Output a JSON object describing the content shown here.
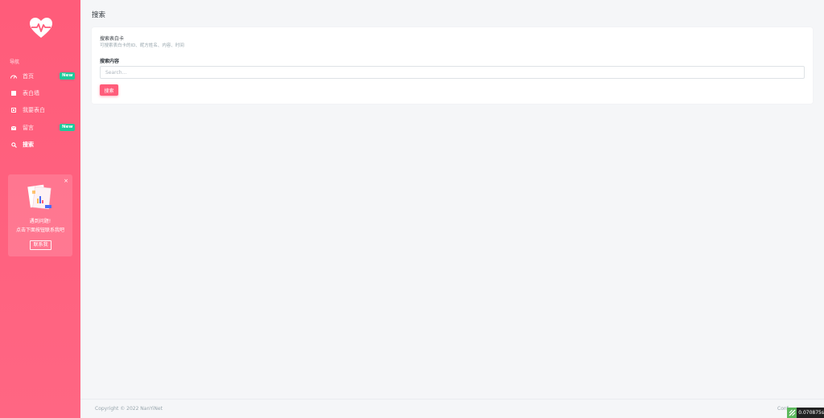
{
  "sidebar": {
    "nav_heading": "导航",
    "items": [
      {
        "label": "首页",
        "icon": "dashboard-icon",
        "badge": "New"
      },
      {
        "label": "表白墙",
        "icon": "grid-icon",
        "badge": ""
      },
      {
        "label": "我要表白",
        "icon": "edit-square-icon",
        "badge": ""
      },
      {
        "label": "留言",
        "icon": "message-icon",
        "badge": "New"
      },
      {
        "label": "搜索",
        "icon": "search-icon",
        "badge": ""
      }
    ],
    "promo": {
      "line1": "遇到问题!",
      "line2": "点击下面按钮联系我吧",
      "button": "联系我"
    }
  },
  "main": {
    "page_title": "搜索",
    "card": {
      "title": "搜索表白卡",
      "subtitle": "可搜索表白卡的ID、昵方姓名、内容、时间",
      "field_label": "搜索内容",
      "search_placeholder": "Search...",
      "search_button": "搜索"
    }
  },
  "footer": {
    "copyright": "Copyright © 2022 NanYiNet",
    "right_text": "Conf"
  },
  "perf_badge": "0.070875s",
  "colors": {
    "accent": "#ff5c7a",
    "badge": "#1fc99a",
    "background": "#f5f6f8"
  }
}
